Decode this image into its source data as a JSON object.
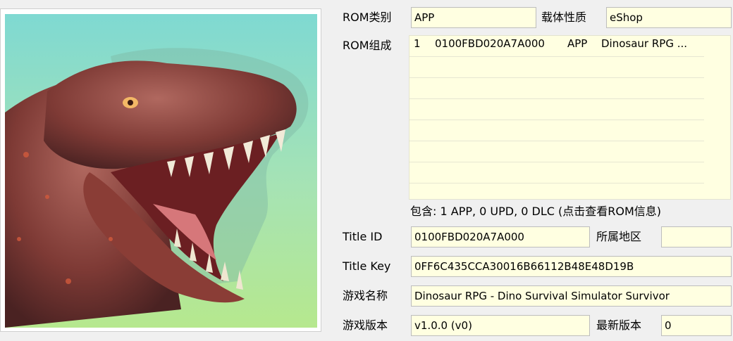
{
  "rom_type": {
    "label": "ROM类别",
    "value": "APP"
  },
  "carrier": {
    "label": "载体性质",
    "value": "eShop"
  },
  "rom_content": {
    "label": "ROM组成",
    "rows": [
      {
        "index": "1",
        "title_id": "0100FBD020A7A000",
        "type": "APP",
        "name": "Dinosaur RPG ..."
      }
    ]
  },
  "contains_hint": "包含: 1 APP, 0 UPD, 0 DLC (点击查看ROM信息)",
  "title_id": {
    "label": "Title ID",
    "value": "0100FBD020A7A000"
  },
  "region": {
    "label": "所属地区",
    "value": ""
  },
  "title_key": {
    "label": "Title Key",
    "value": "0FF6C435CCA30016B66112B48E48D19B"
  },
  "game_name": {
    "label": "游戏名称",
    "value": "Dinosaur RPG - Dino Survival Simulator Survivor"
  },
  "game_version": {
    "label": "游戏版本",
    "value": "v1.0.0 (v0)"
  },
  "latest_version": {
    "label": "最新版本",
    "value": "0"
  },
  "colors": {
    "field_bg": "#ffffe1",
    "window_bg": "#f0f0f0"
  }
}
